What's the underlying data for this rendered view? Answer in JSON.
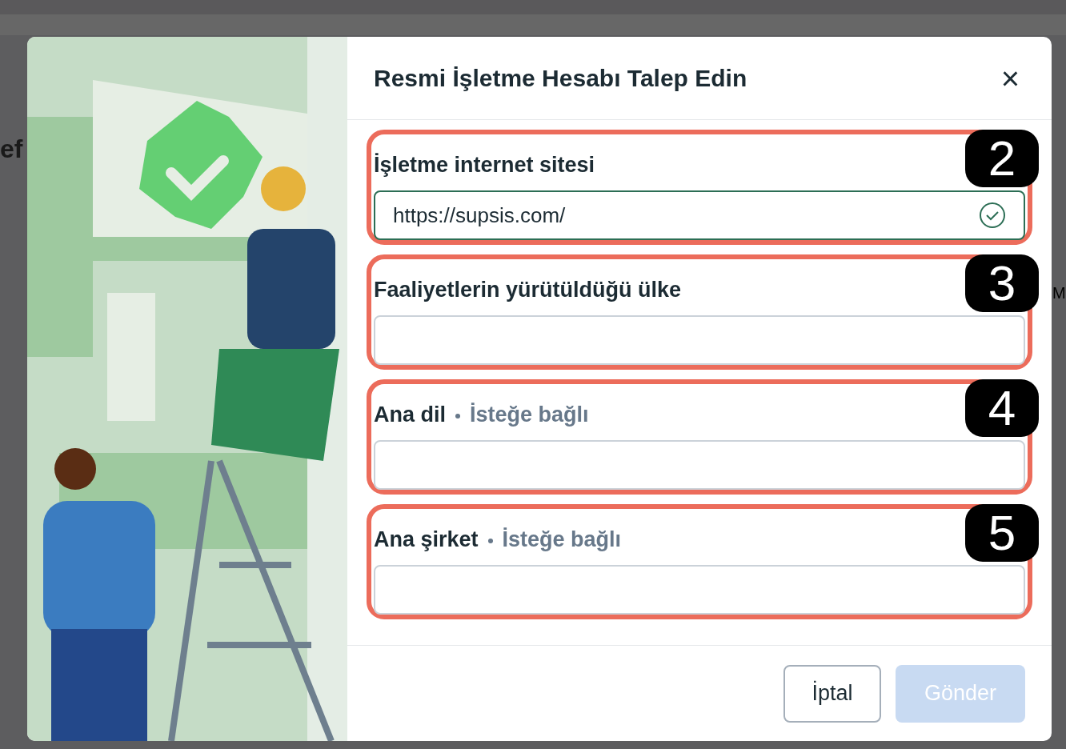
{
  "background": {
    "texts": [
      "ef",
      "M"
    ]
  },
  "dialog": {
    "title": "Resmi İşletme Hesabı Talep Edin",
    "close": "×",
    "fields": [
      {
        "label": "İşletme internet sitesi",
        "value": "https://supsis.com/",
        "valid": true,
        "annotation": "2"
      },
      {
        "label": "Faaliyetlerin yürütüldüğü ülke",
        "valid": false,
        "annotation": "3"
      },
      {
        "label": "Ana dil",
        "optional": "İsteğe bağlı",
        "valid": false,
        "annotation": "4"
      },
      {
        "label": "Ana şirket",
        "optional": "İsteğe bağlı",
        "valid": false,
        "annotation": "5"
      }
    ],
    "buttons": [
      {
        "label": "İptal",
        "kind": "secondary",
        "disabled": false
      },
      {
        "label": "Gönder",
        "kind": "primary",
        "disabled": true
      }
    ]
  }
}
